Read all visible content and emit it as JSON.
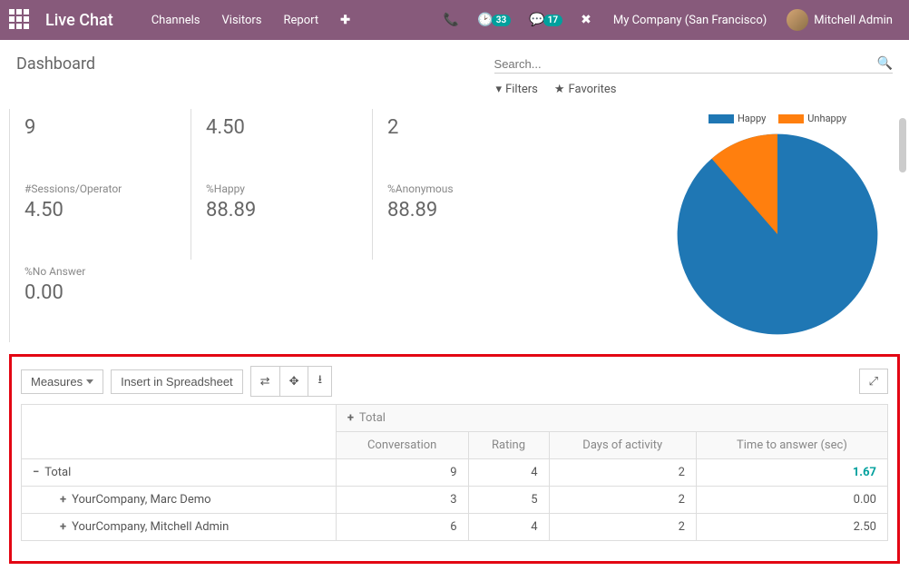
{
  "topbar": {
    "app_title": "Live Chat",
    "nav": [
      "Channels",
      "Visitors",
      "Report"
    ],
    "activity_count": "33",
    "msg_count": "17",
    "company": "My Company (San Francisco)",
    "username": "Mitchell Admin"
  },
  "header": {
    "page_title": "Dashboard",
    "search_placeholder": "Search...",
    "filters_label": "Filters",
    "favorites_label": "Favorites"
  },
  "stats": {
    "r1c1": {
      "label": "",
      "value": "9"
    },
    "r1c2": {
      "label": "",
      "value": "4.50"
    },
    "r1c3": {
      "label": "",
      "value": "2"
    },
    "r2c1": {
      "label": "#Sessions/Operator",
      "value": "4.50"
    },
    "r2c2": {
      "label": "%Happy",
      "value": "88.89"
    },
    "r2c3": {
      "label": "%Anonymous",
      "value": "88.89"
    },
    "r3c1": {
      "label": "%No Answer",
      "value": "0.00"
    }
  },
  "chart_data": {
    "type": "pie",
    "legend": [
      {
        "name": "Happy",
        "color": "#1f77b4",
        "value": 88.89
      },
      {
        "name": "Unhappy",
        "color": "#ff7f0e",
        "value": 11.11
      }
    ]
  },
  "pivot": {
    "measures_btn": "Measures",
    "spreadsheet_btn": "Insert in Spreadsheet",
    "total_label": "Total",
    "columns": [
      "Conversation",
      "Rating",
      "Days of activity",
      "Time to answer (sec)"
    ],
    "rows": [
      {
        "label": "Total",
        "expand": "−",
        "indent": 0,
        "values": [
          "9",
          "4",
          "2",
          "1.67"
        ],
        "highlight_last": true
      },
      {
        "label": "YourCompany, Marc Demo",
        "expand": "+",
        "indent": 1,
        "values": [
          "3",
          "5",
          "2",
          "0.00"
        ]
      },
      {
        "label": "YourCompany, Mitchell Admin",
        "expand": "+",
        "indent": 1,
        "values": [
          "6",
          "4",
          "2",
          "2.50"
        ]
      }
    ]
  }
}
